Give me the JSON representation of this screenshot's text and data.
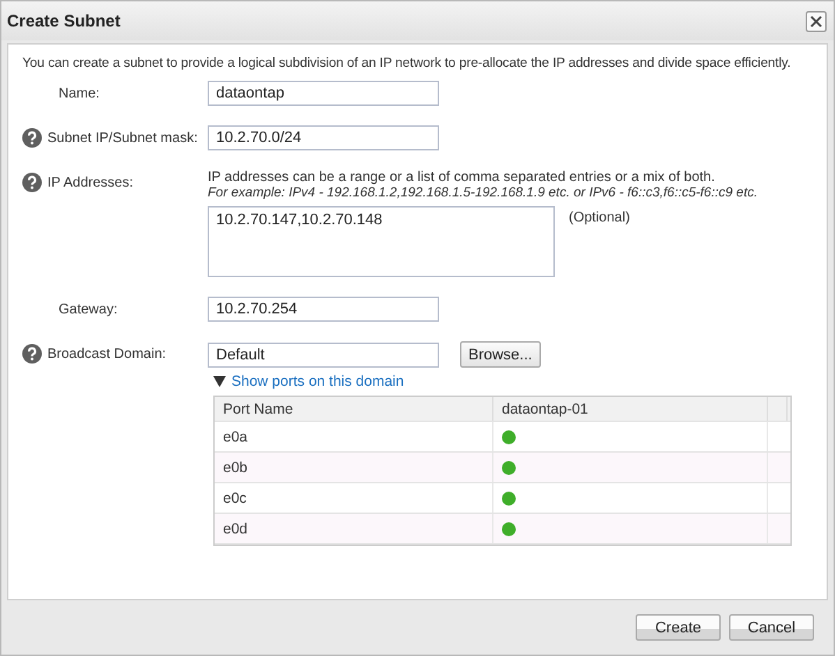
{
  "window": {
    "title": "Create Subnet"
  },
  "intro": "You can create a subnet to provide a logical subdivision of an IP network to pre-allocate the IP addresses and divide space efficiently.",
  "fields": [
    {
      "kind": "text",
      "label": "Name:",
      "help": false,
      "value": "dataontap"
    },
    {
      "kind": "text",
      "label": "Subnet IP/Subnet mask:",
      "help": true,
      "value": "10.2.70.0/24"
    },
    {
      "kind": "textarea",
      "label": "IP Addresses:",
      "help": true,
      "hint": "IP addresses can be a range or a list of comma separated entries or a mix of both.",
      "example": "For example: IPv4 - 192.168.1.2,192.168.1.5-192.168.1.9 etc. or IPv6 - f6::c3,f6::c5-f6::c9 etc.",
      "value": "10.2.70.147,10.2.70.148",
      "note": "(Optional)"
    },
    {
      "kind": "text",
      "label": "Gateway:",
      "help": false,
      "value": "10.2.70.254"
    },
    {
      "kind": "browse",
      "label": "Broadcast Domain:",
      "help": true,
      "value": "Default",
      "button": "Browse..."
    }
  ],
  "ports": {
    "toggle": "Show ports on this domain",
    "expanded": true,
    "columns": [
      "Port Name",
      "dataontap-01"
    ],
    "rows": [
      {
        "port": "e0a",
        "color": "#3fae2a"
      },
      {
        "port": "e0b",
        "color": "#3fae2a"
      },
      {
        "port": "e0c",
        "color": "#3fae2a"
      },
      {
        "port": "e0d",
        "color": "#3fae2a"
      }
    ]
  },
  "buttons": [
    "Create",
    "Cancel"
  ]
}
